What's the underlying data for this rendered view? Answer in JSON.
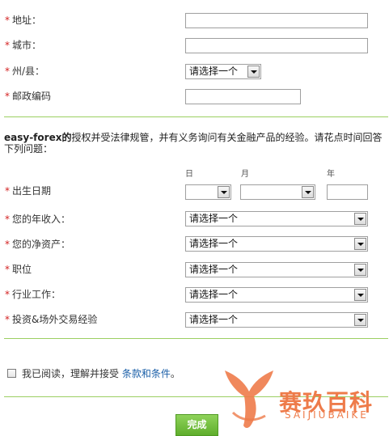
{
  "address": {
    "star": "*",
    "label": "地址："
  },
  "city": {
    "star": "*",
    "label": "城市："
  },
  "state": {
    "star": "*",
    "label": "州/县：",
    "selected": "请选择一个"
  },
  "postal": {
    "star": "*",
    "label": "邮政编码"
  },
  "intro": {
    "brand": "easy-forex的",
    "text": "授权并受法律规管，并有义务询问有关金融产品的经验。请花点时间回答下列问题："
  },
  "dob": {
    "star": "*",
    "label": "出生日期",
    "day_label": "日",
    "month_label": "月",
    "year_label": "年"
  },
  "income": {
    "star": "*",
    "label": "您的年收入：",
    "selected": "请选择一个"
  },
  "net_assets": {
    "star": "*",
    "label": "您的净资产：",
    "selected": "请选择一个"
  },
  "position": {
    "star": "*",
    "label": "职位",
    "selected": "请选择一个"
  },
  "industry": {
    "star": "*",
    "label": "行业工作：",
    "selected": "请选择一个"
  },
  "experience": {
    "star": "*",
    "label": "投资&场外交易经验",
    "selected": "请选择一个"
  },
  "agreement": {
    "prefix": "我已阅读，理解并接受 ",
    "link": "条款和条件",
    "suffix": "。"
  },
  "submit": {
    "label": "完成"
  },
  "watermark": {
    "text": "赛玖百科",
    "sub": "SAIJIUBAIKE",
    "color": "#ee7b4a"
  },
  "colors": {
    "required_star": "#d32222",
    "divider": "#9bcf62",
    "button": "#6fbf3a",
    "link": "#1b5fa8"
  }
}
